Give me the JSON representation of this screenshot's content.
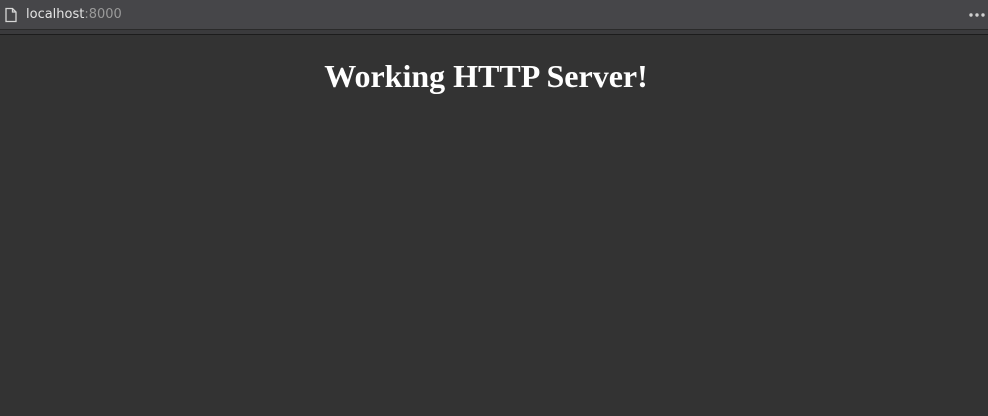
{
  "browser": {
    "address": {
      "host": "localhost",
      "port": ":8000"
    },
    "icons": {
      "page": "document-page-icon",
      "menu": "more-horizontal-icon"
    },
    "colors": {
      "toolbar_background": "#464649",
      "page_background": "#333333",
      "host_text": "#e4e4e4",
      "port_text": "#9a9a9a",
      "heading_text": "#ffffff"
    }
  },
  "page": {
    "heading": "Working HTTP Server!"
  }
}
